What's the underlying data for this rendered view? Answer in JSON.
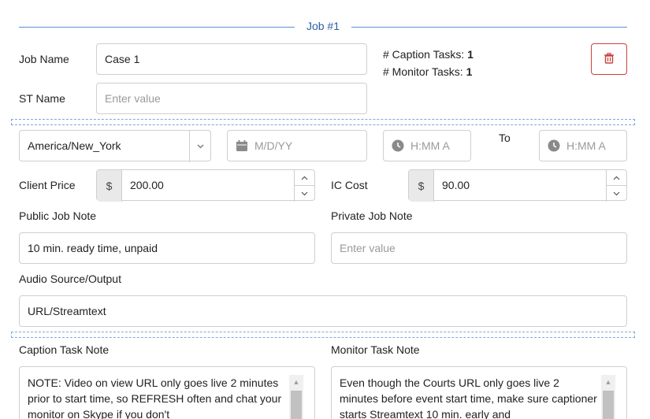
{
  "job": {
    "title": "Job #1",
    "name_label": "Job Name",
    "name_value": "Case 1",
    "st_label": "ST Name",
    "st_placeholder": "Enter value",
    "caption_tasks_label": "# Caption Tasks:",
    "caption_tasks_count": "1",
    "monitor_tasks_label": "# Monitor Tasks:",
    "monitor_tasks_count": "1"
  },
  "schedule": {
    "timezone": "America/New_York",
    "date_placeholder": "M/D/YY",
    "start_placeholder": "H:MM A",
    "to_label": "To",
    "end_placeholder": "H:MM A"
  },
  "pricing": {
    "client_price_label": "Client Price",
    "currency_symbol": "$",
    "client_price_value": "200.00",
    "ic_cost_label": "IC Cost",
    "ic_cost_value": "90.00"
  },
  "notes": {
    "public_label": "Public Job Note",
    "public_value": "10 min. ready time, unpaid",
    "private_label": "Private Job Note",
    "private_placeholder": "Enter value",
    "audio_label": "Audio Source/Output",
    "audio_value": "URL/Streamtext",
    "caption_task_label": "Caption Task Note",
    "caption_task_value": "NOTE: Video on view URL only goes live 2 minutes prior to start time, so REFRESH often and chat your monitor on Skype if you don't",
    "monitor_task_label": "Monitor Task Note",
    "monitor_task_value": "Even though the Courts URL only goes live 2 minutes before event start time, make sure captioner starts Streamtext 10 min. early and"
  },
  "colors": {
    "accent": "#2b5fa8",
    "danger": "#c9423b",
    "border": "#cfcfcf"
  },
  "icons": {
    "delete": "trash-icon",
    "date": "calendar-icon",
    "time": "clock-icon"
  }
}
